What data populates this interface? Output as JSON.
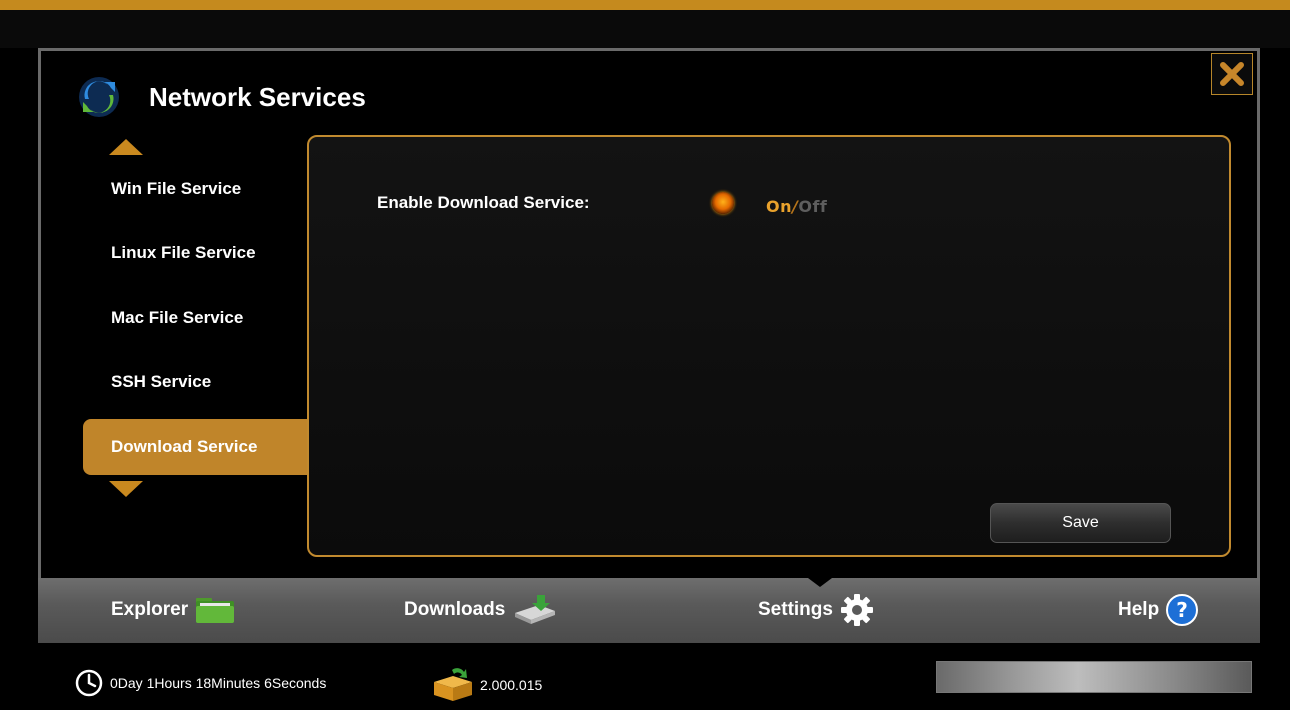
{
  "window": {
    "title": "Network Services",
    "close_label": "close"
  },
  "sidebar": {
    "items": [
      {
        "label": "Win File Service"
      },
      {
        "label": "Linux File Service"
      },
      {
        "label": "Mac File Service"
      },
      {
        "label": "SSH Service"
      },
      {
        "label": "Download Service",
        "active": true
      }
    ]
  },
  "panel": {
    "setting_label": "Enable Download Service:",
    "toggle_on": "On",
    "toggle_sep": "/",
    "toggle_off": "Off",
    "selected": "On",
    "save_label": "Save"
  },
  "bottom_nav": {
    "explorer": "Explorer",
    "downloads": "Downloads",
    "settings": "Settings",
    "help": "Help",
    "active": "Settings"
  },
  "status": {
    "uptime": "0Day 1Hours 18Minutes 6Seconds",
    "version": "2.000.015"
  },
  "colors": {
    "accent": "#c0852a",
    "background": "#000000",
    "nav_bar": "#5a5a5a"
  },
  "icons": {
    "app": "refresh-arrows-icon",
    "close": "close-x-icon",
    "explorer": "folder-icon",
    "downloads": "download-drive-icon",
    "settings": "gear-icon",
    "help": "question-circle-icon",
    "uptime": "clock-icon",
    "version": "package-icon"
  }
}
